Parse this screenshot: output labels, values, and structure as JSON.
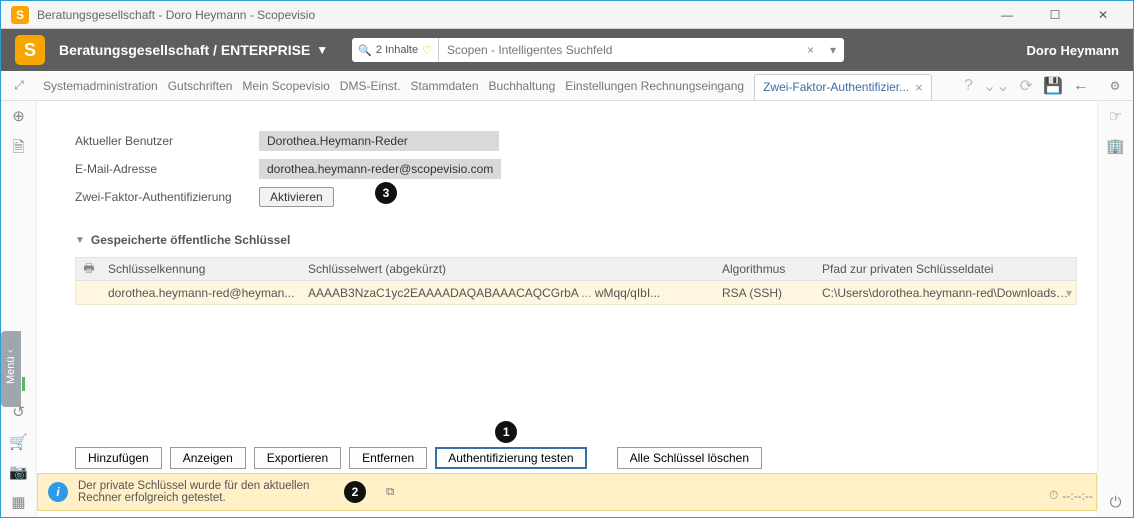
{
  "window": {
    "title": "Beratungsgesellschaft - Doro Heymann - Scopevisio",
    "appGlyph": "S"
  },
  "topbar": {
    "org_label": "Beratungsgesellschaft / ENTERPRISE",
    "search_count": "2 Inhalte",
    "search_placeholder": "Scopen - Intelligentes Suchfeld",
    "username": "Doro Heymann"
  },
  "breadcrumbs": {
    "items": [
      "Systemadministration",
      "Gutschriften",
      "Mein Scopevisio",
      "DMS-Einst.",
      "Stammdaten",
      "Buchhaltung",
      "Einstellungen Rechnungseingang"
    ],
    "active_tab": "Zwei-Faktor-Authentifizier..."
  },
  "form": {
    "current_user_label": "Aktueller Benutzer",
    "current_user_value": "Dorothea.Heymann-Reder",
    "email_label": "E-Mail-Adresse",
    "email_value": "dorothea.heymann-reder@scopevisio.com",
    "twofa_label": "Zwei-Faktor-Authentifizierung",
    "activate_btn": "Aktivieren"
  },
  "section": {
    "title": "Gespeicherte öffentliche Schlüssel",
    "columns": {
      "c1": "Schlüsselkennung",
      "c2": "Schlüsselwert (abgekürzt)",
      "c3": "Algorithmus",
      "c4": "Pfad zur privaten Schlüsseldatei"
    },
    "rows": [
      {
        "id": "dorothea.heymann-red@heyman...",
        "value_a": "AAAAB3NzaC1yc2EAAAADAQABAAACAQCGrbA",
        "value_b": "wMqq/qIbI...",
        "algo": "RSA (SSH)",
        "path": "C:\\Users\\dorothea.heymann-red\\Downloads\\s..."
      }
    ]
  },
  "buttons": {
    "add": "Hinzufügen",
    "show": "Anzeigen",
    "export": "Exportieren",
    "remove": "Entfernen",
    "test": "Authentifizierung testen",
    "delete_all": "Alle Schlüssel löschen"
  },
  "status": {
    "message": "Der private Schlüssel wurde für den aktuellen Rechner erfolgreich getestet."
  },
  "timer": "--:--:--",
  "annotations": {
    "one": "1",
    "two": "2",
    "three": "3"
  },
  "ellipsis": "..."
}
